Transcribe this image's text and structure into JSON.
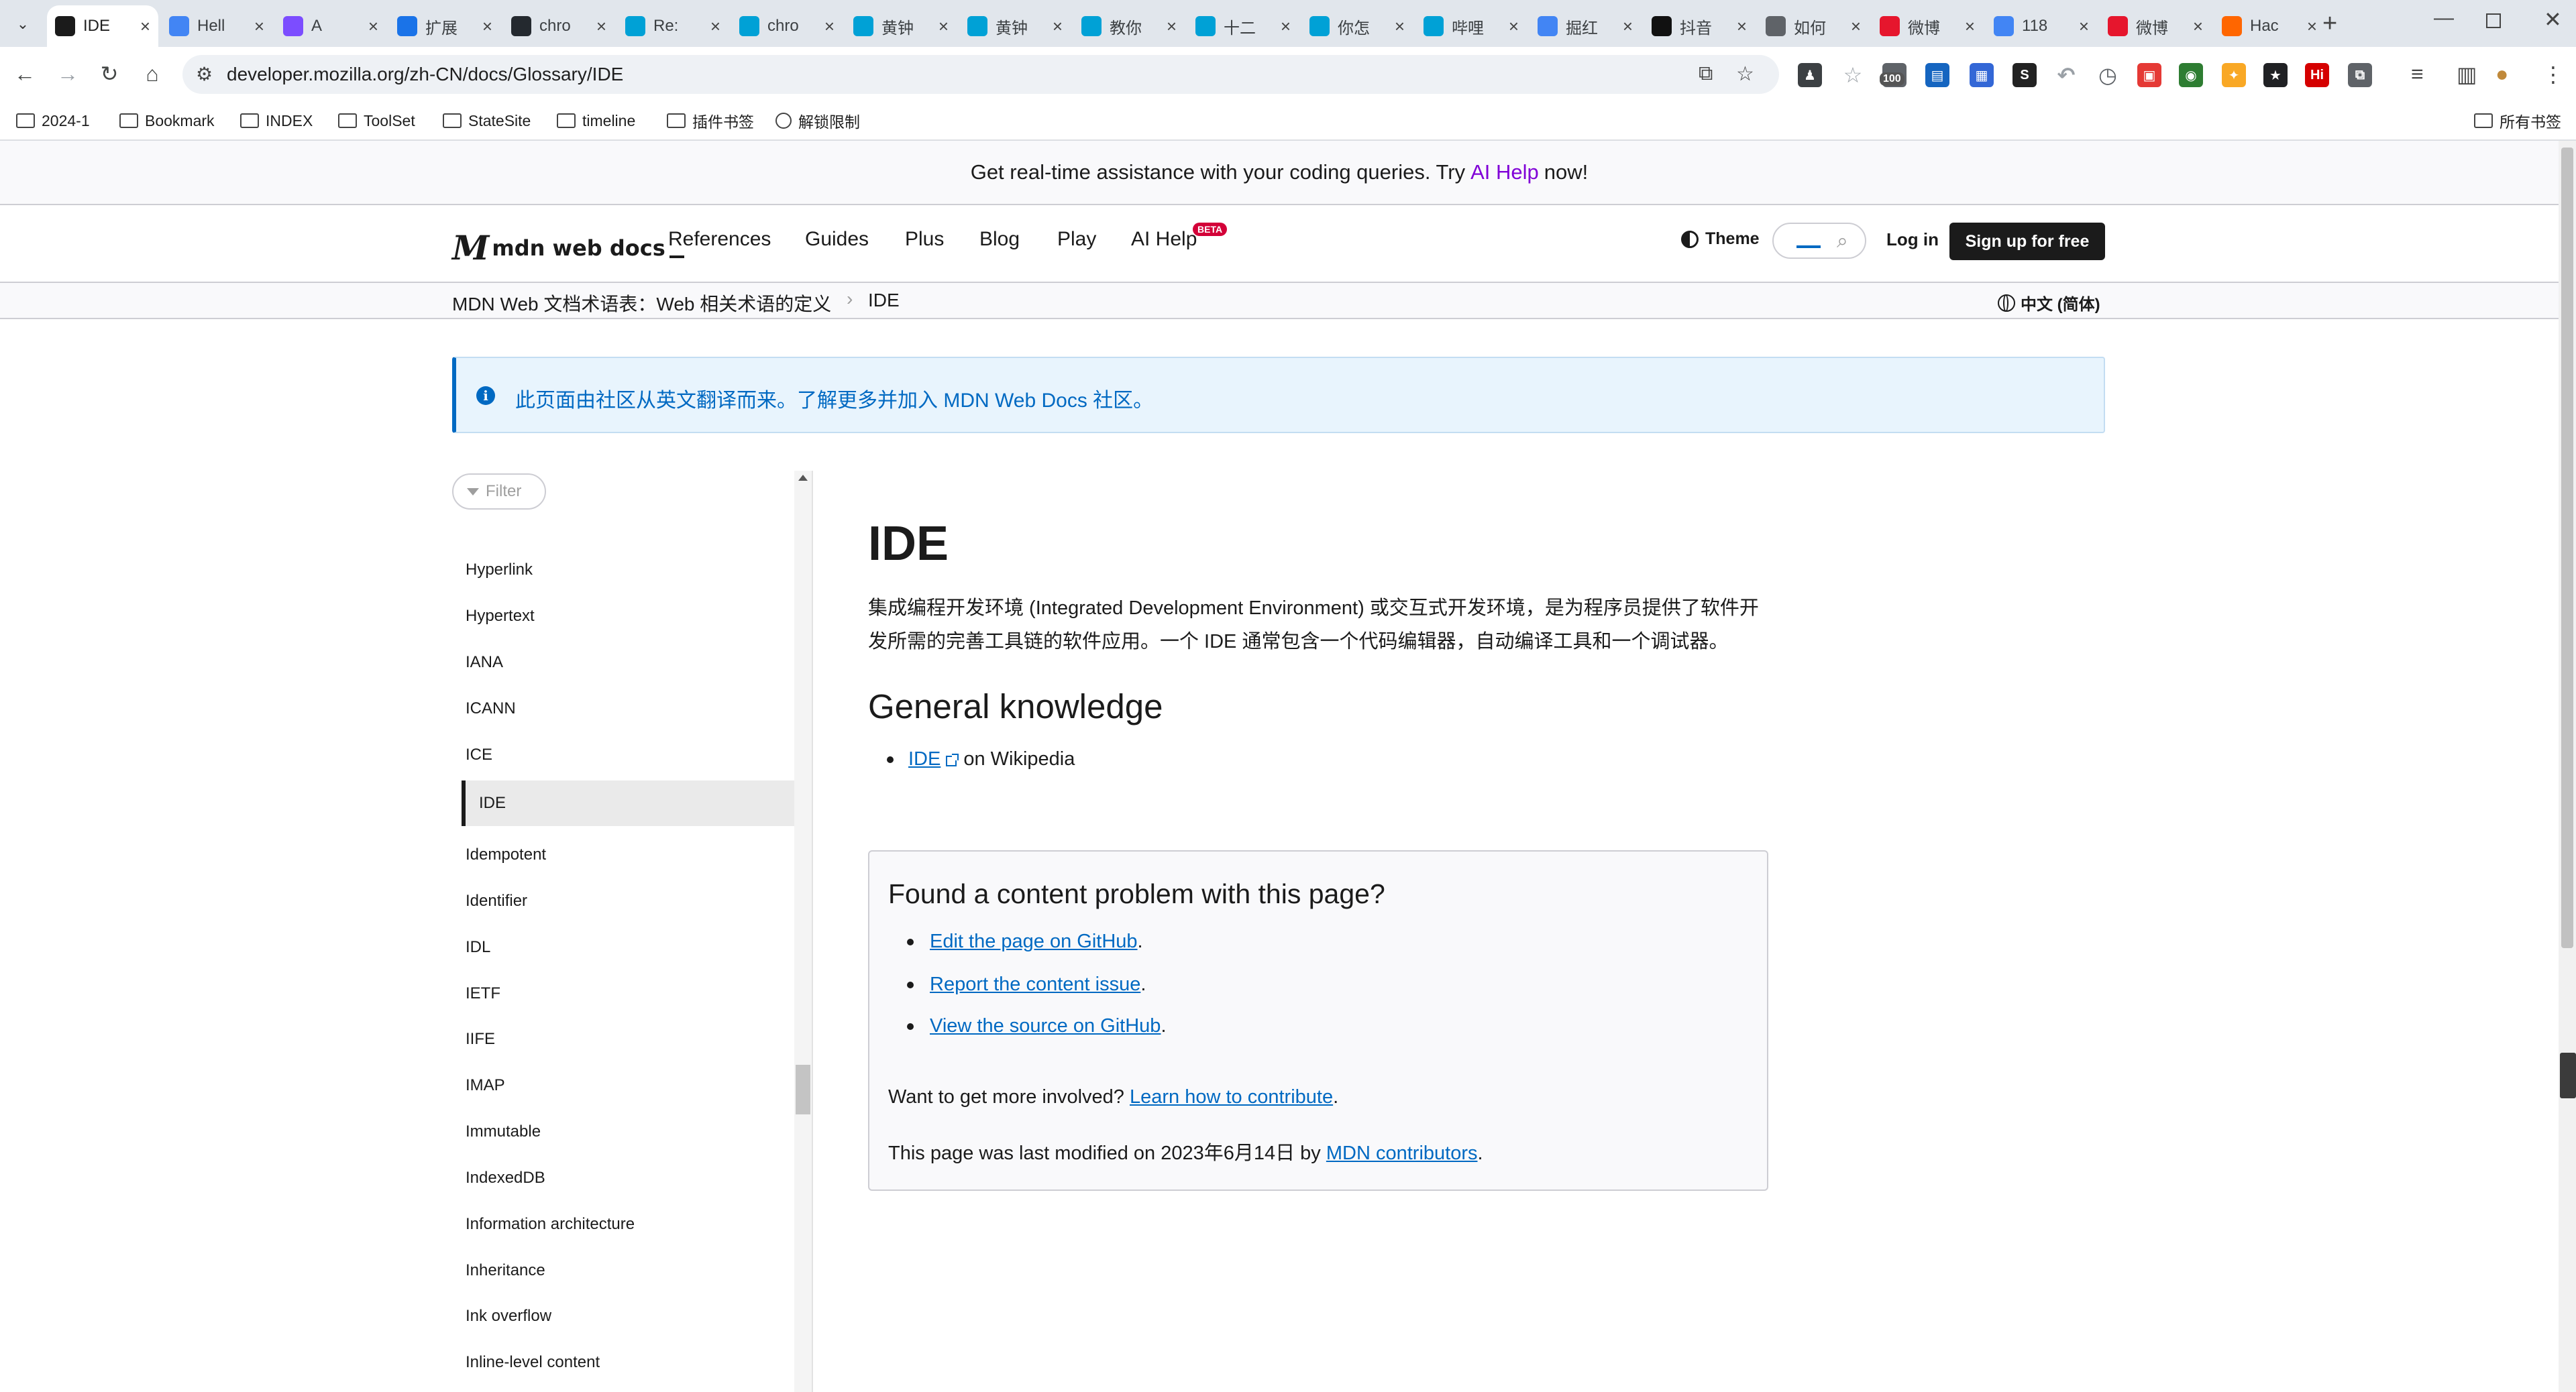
{
  "browser": {
    "tabs": [
      {
        "label": "IDE",
        "icon": "mdn-favicon",
        "color": "#1b1b1b",
        "active": true
      },
      {
        "label": "Hell",
        "icon": "chrome-favicon",
        "color": "#4285f4"
      },
      {
        "label": "A",
        "icon": "loader-favicon",
        "color": "#7c4dff"
      },
      {
        "label": "扩展",
        "icon": "puzzle-favicon",
        "color": "#1a73e8"
      },
      {
        "label": "chro",
        "icon": "github-favicon",
        "color": "#24292f"
      },
      {
        "label": "Re:",
        "icon": "bilibili-favicon",
        "color": "#00a1d6"
      },
      {
        "label": "chro",
        "icon": "bilibili-favicon",
        "color": "#00a1d6"
      },
      {
        "label": "黄钟",
        "icon": "bilibili-favicon",
        "color": "#00a1d6"
      },
      {
        "label": "黄钟",
        "icon": "bilibili-favicon",
        "color": "#00a1d6"
      },
      {
        "label": "教你",
        "icon": "bilibili-favicon",
        "color": "#00a1d6"
      },
      {
        "label": "十二",
        "icon": "bilibili-favicon",
        "color": "#00a1d6"
      },
      {
        "label": "你怎",
        "icon": "bilibili-favicon",
        "color": "#00a1d6"
      },
      {
        "label": "哔哩",
        "icon": "bilibili-favicon",
        "color": "#00a1d6"
      },
      {
        "label": "掘红",
        "icon": "google-favicon",
        "color": "#4285f4"
      },
      {
        "label": "抖音",
        "icon": "douyin-favicon",
        "color": "#111111"
      },
      {
        "label": "如何",
        "icon": "globe-favicon",
        "color": "#5f6368"
      },
      {
        "label": "微博",
        "icon": "weibo-favicon",
        "color": "#e6162d"
      },
      {
        "label": "118",
        "icon": "google-favicon",
        "color": "#4285f4"
      },
      {
        "label": "微博",
        "icon": "weibo-favicon",
        "color": "#e6162d"
      },
      {
        "label": "Hac",
        "icon": "hackernews-favicon",
        "color": "#ff6600"
      }
    ],
    "url": "developer.mozilla.org/zh-CN/docs/Glossary/IDE",
    "bookmarks": [
      {
        "label": "2024-1"
      },
      {
        "label": "Bookmark"
      },
      {
        "label": "INDEX"
      },
      {
        "label": "ToolSet"
      },
      {
        "label": "StateSite"
      },
      {
        "label": "timeline"
      },
      {
        "label": "插件书签"
      },
      {
        "label": "解锁限制"
      }
    ],
    "all_bookmarks_label": "所有书签",
    "extension_badge": "100"
  },
  "banner": {
    "text_before": "Get real-time assistance with your coding queries. Try",
    "link": "AI Help",
    "text_after": "now!"
  },
  "header": {
    "logo_text": "mdn web docs",
    "nav": [
      "References",
      "Guides",
      "Plus",
      "Blog",
      "Play",
      "AI Help"
    ],
    "beta_badge": "BETA",
    "theme_label": "Theme",
    "login_label": "Log in",
    "signup_label": "Sign up for free"
  },
  "breadcrumb": {
    "items": [
      "MDN Web 文档术语表：Web 相关术语的定义",
      "IDE"
    ],
    "language": "中文 (简体)"
  },
  "notecard": {
    "text": "此页面由社区从英文翻译而来。了解更多并加入 MDN Web Docs 社区。"
  },
  "sidebar": {
    "filter_placeholder": "Filter",
    "items": [
      "Hyperlink",
      "Hypertext",
      "IANA",
      "ICANN",
      "ICE",
      "IDE",
      "Idempotent",
      "Identifier",
      "IDL",
      "IETF",
      "IIFE",
      "IMAP",
      "Immutable",
      "IndexedDB",
      "Information architecture",
      "Inheritance",
      "Ink overflow",
      "Inline-level content"
    ],
    "current_index": 5
  },
  "article": {
    "title": "IDE",
    "intro_line1": "集成编程开发环境 (Integrated Development Environment) 或交互式开发环境，是为程序员提供了软件开",
    "intro_line2": "发所需的完善工具链的软件应用。一个 IDE 通常包含一个代码编辑器，自动编译工具和一个调试器。",
    "section_title": "General knowledge",
    "wiki_link": "IDE",
    "wiki_suffix": "on Wikipedia"
  },
  "feedback": {
    "title": "Found a content problem with this page?",
    "links": [
      {
        "text": "Edit the page on GitHub",
        "suffix": "."
      },
      {
        "text": "Report the content issue",
        "suffix": "."
      },
      {
        "text": "View the source on GitHub",
        "suffix": "."
      }
    ],
    "involve_text": "Want to get more involved?",
    "involve_link": "Learn how to contribute",
    "involve_suffix": ".",
    "modified_text": "This page was last modified on 2023年6月14日 by",
    "modified_link": "MDN contributors",
    "modified_suffix": "."
  },
  "colors": {
    "link_blue": "#0069c2",
    "ai_help_purple": "#8000d7",
    "note_bg": "#e8f4fd",
    "text": "#1b1b1b"
  }
}
